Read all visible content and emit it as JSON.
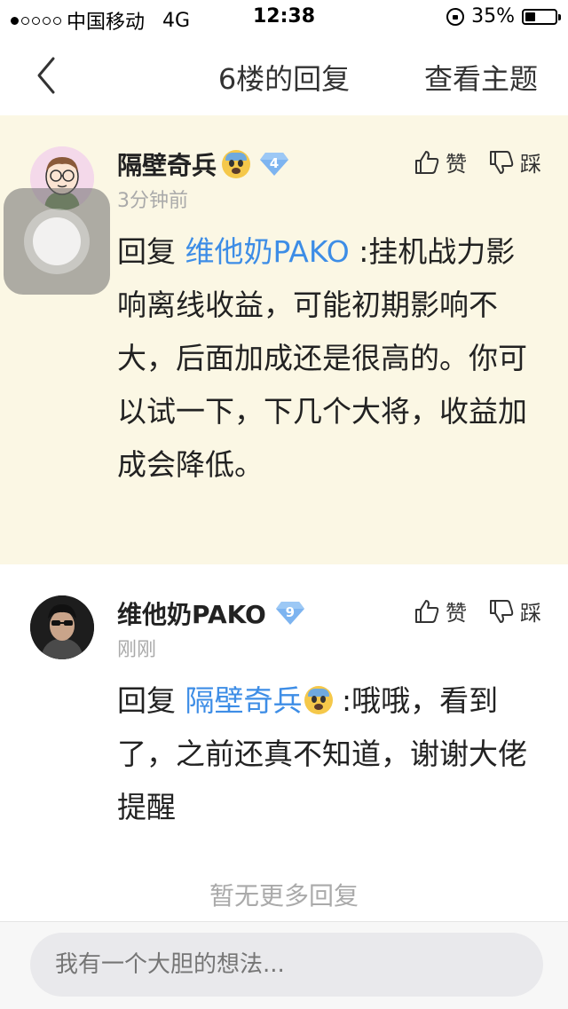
{
  "status_bar": {
    "carrier": "中国移动",
    "network": "4G",
    "time": "12:38",
    "battery": "35%",
    "battery_level": 0.35
  },
  "nav": {
    "title": "6楼的回复",
    "right_label": "查看主题"
  },
  "replies": [
    {
      "username": "隔壁奇兵",
      "level": "4",
      "time": "3分钟前",
      "like_label": "赞",
      "dislike_label": "踩",
      "reply_prefix": "回复",
      "mention": "维他奶PAKO",
      "text": ":挂机战力影响离线收益，可能初期影响不大，后面加成还是很高的。你可以试一下，下几个大将，收益加成会降低。"
    },
    {
      "username": "维他奶PAKO",
      "level": "9",
      "time": "刚刚",
      "like_label": "赞",
      "dislike_label": "踩",
      "reply_prefix": "回复",
      "mention": "隔壁奇兵",
      "text": ":哦哦，看到了，之前还真不知道，谢谢大佬提醒"
    }
  ],
  "no_more": "暂无更多回复",
  "input": {
    "placeholder": "我有一个大胆的想法..."
  },
  "colors": {
    "highlight_bg": "#fbf7e4",
    "mention": "#3d8de6",
    "level_badge": "#7db4f0"
  }
}
